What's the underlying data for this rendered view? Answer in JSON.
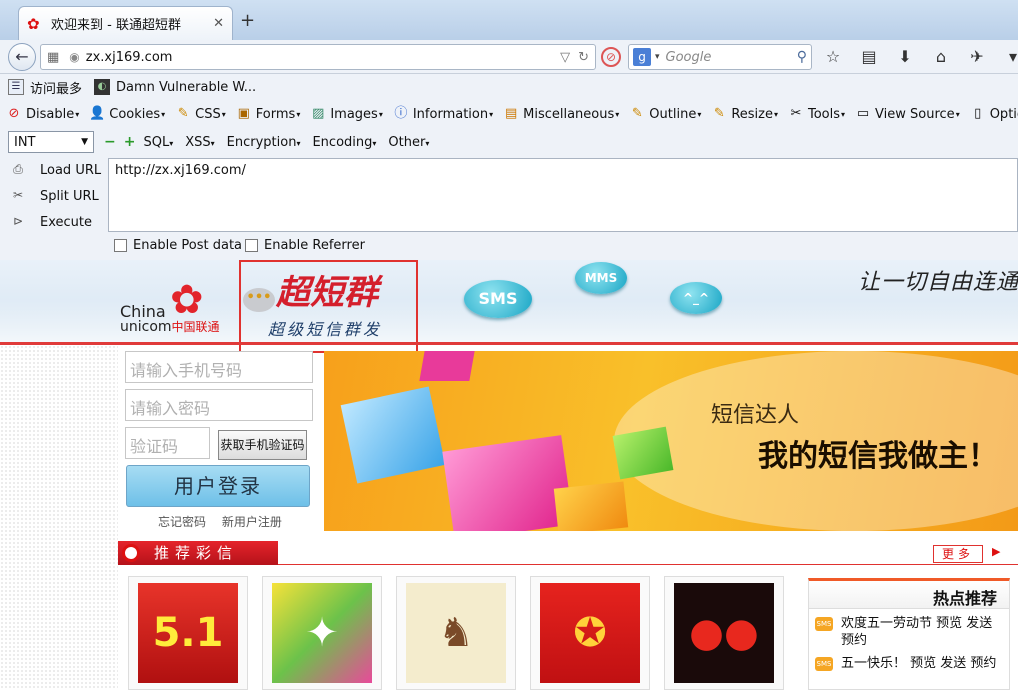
{
  "tab": {
    "title": "欢迎来到 - 联通超短群",
    "close": "✕",
    "new_tab": "+"
  },
  "nav": {
    "url": "zx.xj169.com",
    "search_placeholder": "Google"
  },
  "bookmarks": [
    {
      "label": "访问最多"
    },
    {
      "label": "Damn Vulnerable W..."
    }
  ],
  "webdev": {
    "items": [
      "Disable",
      "Cookies",
      "CSS",
      "Forms",
      "Images",
      "Information",
      "Miscellaneous",
      "Outline",
      "Resize",
      "Tools",
      "View Source",
      "Options"
    ]
  },
  "hackbar": {
    "select_value": "INT",
    "menus": [
      "SQL",
      "XSS",
      "Encryption",
      "Encoding",
      "Other"
    ],
    "load_url": "Load URL",
    "split_url": "Split URL",
    "execute": "Execute",
    "textarea_value": "http://zx.xj169.com/",
    "enable_post": "Enable Post data",
    "enable_referrer": "Enable Referrer"
  },
  "site": {
    "china": "China",
    "unicom": "unicom",
    "unicom_cn": "中国联通",
    "brand": "超短群",
    "brand_sub": "超级短信群发",
    "bubble_sms": "SMS",
    "bubble_mms": "MMS",
    "bubble_smile": "^_^",
    "slogan": "让一切自由连通",
    "login": {
      "phone_placeholder": "请输入手机号码",
      "password_placeholder": "请输入密码",
      "code_placeholder": "验证码",
      "get_code": "获取手机验证码",
      "login_button": "用户登录",
      "forgot": "忘记密码",
      "register": "新用户注册"
    },
    "banner": {
      "line1": "短信达人",
      "line2": "我的短信我做主！"
    },
    "section": {
      "title": "推荐彩信",
      "more": "更多"
    },
    "hot": {
      "title": "热点推荐",
      "items": [
        "欢度五一劳动节 预览 发送 预约",
        "五一快乐！ 预览 发送 预约"
      ]
    }
  },
  "colors": {
    "brand_red": "#e0322f",
    "bubble": "#16a4c4",
    "banner_orange": "#f7a01b"
  }
}
